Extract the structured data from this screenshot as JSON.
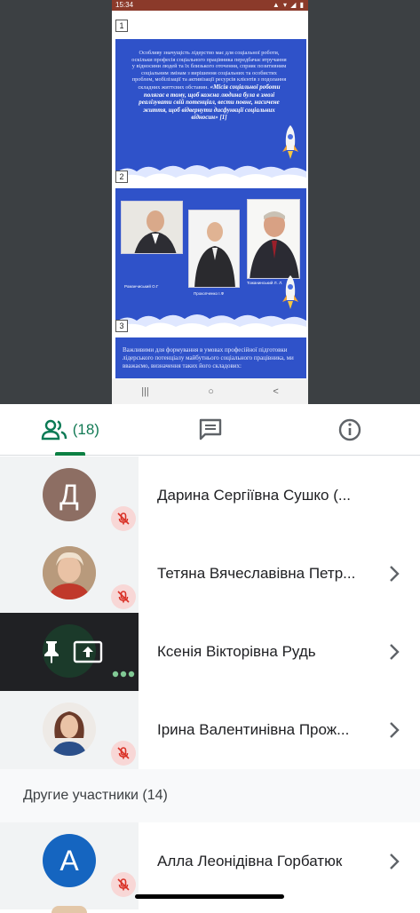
{
  "status_bar": {
    "time": "15:34",
    "icons": "▲ ▾ ◢ ▮"
  },
  "presentation": {
    "pages": [
      "1",
      "2",
      "3"
    ],
    "slide1_text": "Особливу значущість лідерство має для соціальної роботи, оскільки професія соціального працівника передбачає втручання у відносини людей та їх близького оточення, сприяє позитивним соціальним змінам з вирішення соціальних та особистих проблем, мобілізації та активізації ресурсів клієнтів з подолання складних життєвих обставин.",
    "slide1_quote": "«Місія соціальної роботи полягає в тому, щоб кожна людина була в змозі реалізувати свій потенціал, вести повне, насичене життя, щоб відвернути дисфункції соціальних відносин» [1]",
    "captions": [
      "Романчиський О.Г",
      "Прокопченко І.Ф",
      "Тожанинський Л. Л."
    ],
    "slide3_text": "Важливими для формування в умовах професійної підготовки лідерського потенціалу майбутнього соціального працівника, ми вважаємо, визначення таких його складових:"
  },
  "navbar": {
    "recents": "|||",
    "home": "○",
    "back": "<"
  },
  "tabs": {
    "people_count": "(18)",
    "people_icon": "people-icon",
    "chat_icon": "chat-icon",
    "info_icon": "info-icon"
  },
  "participants": [
    {
      "initial": "Д",
      "name": "Дарина Сергіївна Сушко (...",
      "avatar_color": "#8d6e63",
      "muted": true
    },
    {
      "initial": "",
      "name": "Тетяна Вячеславівна Петр...",
      "avatar_color": "#d9b38c",
      "muted": true
    },
    {
      "initial": "",
      "name": "Ксенія Вікторівна Рудь",
      "avatar_color": "#1b3a2a",
      "muted": false
    },
    {
      "initial": "",
      "name": "Ірина Валентинівна Прож...",
      "avatar_color": "#8a6a5a",
      "muted": true
    }
  ],
  "section_label": "Другие участники (14)",
  "other_participants": [
    {
      "initial": "А",
      "name": "Алла Леонідівна Горбатюк",
      "avatar_color": "#1565c0",
      "muted": true
    }
  ],
  "colors": {
    "accent": "#0b8043",
    "slide_blue": "#2f52c9",
    "mute_bg": "#f8d7d6",
    "mute_icon": "#d93025"
  }
}
